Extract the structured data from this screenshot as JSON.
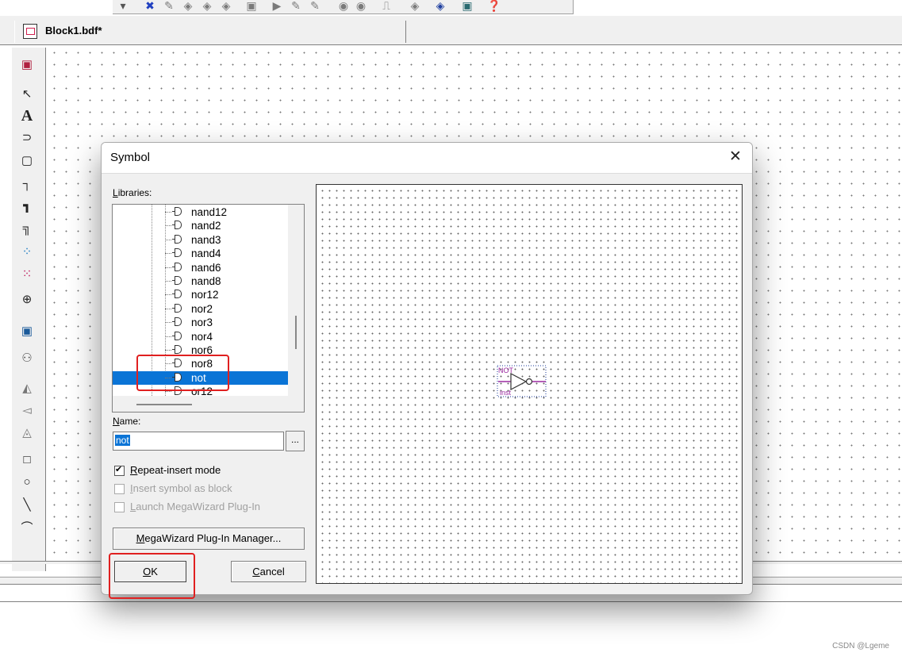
{
  "document_tab": {
    "title": "Block1.bdf*"
  },
  "toolbar": {
    "icons": [
      "dropdown-arrow-icon",
      "compile-icon",
      "edit-icon",
      "analyze-icon",
      "synthesis-icon",
      "fitter-icon",
      "assembler-icon",
      "start-icon",
      "run-icon",
      "debug-icon",
      "timing-icon",
      "simulate-icon",
      "rtl-icon",
      "programmer-icon",
      "chip-icon",
      "help-icon"
    ]
  },
  "palette": {
    "tools": [
      "window-icon",
      "selection-tool-icon",
      "text-tool-icon",
      "symbol-tool-icon",
      "block-tool-icon",
      "orthogonal-node-tool-icon",
      "orthogonal-bus-tool-icon",
      "conduit-tool-icon",
      "partial-line-selection-icon",
      "rubberbanding-icon",
      "zoom-tool-icon",
      "full-screen-icon",
      "find-icon",
      "flip-horizontal-icon",
      "flip-vertical-icon",
      "rotate-icon",
      "rectangle-tool-icon",
      "oval-tool-icon",
      "line-tool-icon",
      "arc-tool-icon"
    ]
  },
  "dialog": {
    "title": "Symbol",
    "close_label": "✕",
    "libraries_label_u": "L",
    "libraries_label_rest": "ibraries:",
    "tree_items": [
      "nand12",
      "nand2",
      "nand3",
      "nand4",
      "nand6",
      "nand8",
      "nor12",
      "nor2",
      "nor3",
      "nor4",
      "nor6",
      "nor8",
      "not",
      "or12"
    ],
    "selected_item": "not",
    "name_label_u": "N",
    "name_label_rest": "ame:",
    "name_value": "not",
    "browse_label": "...",
    "repeat_insert": {
      "u": "R",
      "rest": "epeat-insert mode",
      "checked": true,
      "enabled": true
    },
    "insert_as_block": {
      "u": "I",
      "rest": "nsert symbol as block",
      "checked": false,
      "enabled": false
    },
    "launch_megawizard": {
      "u": "L",
      "rest": "aunch MegaWizard Plug-In",
      "checked": false,
      "enabled": false
    },
    "megawizard_button": {
      "u": "M",
      "rest": "egaWizard Plug-In Manager..."
    },
    "ok_button": {
      "u": "O",
      "rest": "K"
    },
    "cancel_button": {
      "u": "C",
      "rest": "ancel"
    },
    "preview": {
      "symbol_name": "NOT",
      "instance_name": "inst",
      "symbol_color": "#9a2aa0"
    }
  },
  "highlight_color": "#e02020",
  "credit": "CSDN @Lgeme"
}
